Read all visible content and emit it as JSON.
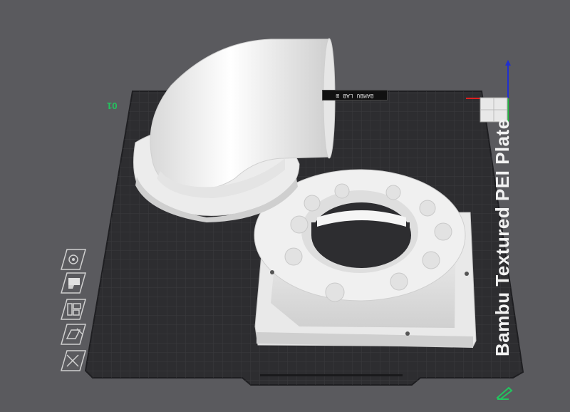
{
  "plate": {
    "label": "Bambu Textured PEI Plate",
    "number": "01",
    "brand_strip": "BAMBU LAB ⊞"
  },
  "objects": [
    {
      "name": "pipe-elbow-with-flange",
      "selected": false
    },
    {
      "name": "fan-adapter-square-mount",
      "selected": false
    }
  ],
  "toolbar": {
    "items": [
      {
        "id": "arrange",
        "icon": "orient-icon"
      },
      {
        "id": "paint",
        "icon": "paint-icon"
      },
      {
        "id": "layout",
        "icon": "layout-icon"
      },
      {
        "id": "edit",
        "icon": "edit-icon"
      },
      {
        "id": "delete",
        "icon": "close-x-icon"
      }
    ]
  },
  "colors": {
    "background": "#5a5a5e",
    "plate": "#2e2e31",
    "grid": "#3d3d41",
    "object": "#f2f2f2",
    "axis_x": "#e02020",
    "axis_y": "#20c040",
    "axis_z": "#2030d0",
    "accent": "#22c55e"
  }
}
